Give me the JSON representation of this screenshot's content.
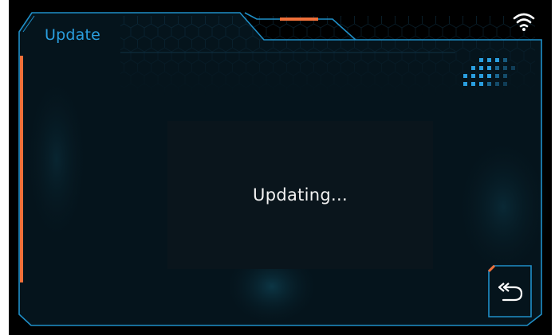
{
  "header": {
    "title": "Update",
    "wifi_icon": "wifi-icon",
    "status_indicator_icon": "signal-grid-icon"
  },
  "dialog": {
    "status_text": "Updating..."
  },
  "footer": {
    "back_icon": "back-arrow-icon"
  },
  "colors": {
    "accent_blue": "#2a9fe0",
    "accent_orange": "#f0703a",
    "frame_line": "#1f8fc8",
    "panel_bg": "#05141c",
    "dialog_bg": "#0a151c",
    "text": "#f2f2f2"
  }
}
